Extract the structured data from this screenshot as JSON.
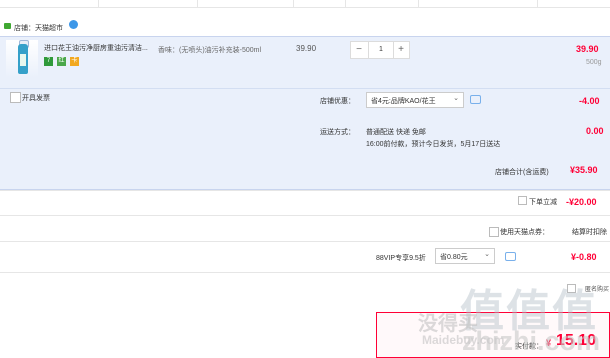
{
  "shop": {
    "label": "店铺：天猫超市"
  },
  "item": {
    "title": "进口花王油污净厨房重油污清洁...",
    "spec": "香味：(无喷头)油污补充装-500ml",
    "unit_price": "39.90",
    "quantity": "1",
    "quantity_minus": "−",
    "quantity_plus": "+",
    "line_price": "39.90",
    "weight": "500g",
    "badges": [
      "7",
      "红",
      "卡"
    ]
  },
  "invoice": {
    "label": "开具发票"
  },
  "promo": {
    "label": "店铺优惠：",
    "selected": "省4元:品牌KAO/花王",
    "chevron": "⌄",
    "amount": "-4.00"
  },
  "shipping": {
    "label": "运送方式：",
    "line1": "普通配送 快递 免邮",
    "line2": "16:00前付款，预计今日发货，5月17日送达",
    "amount": "0.00"
  },
  "subtotal": {
    "label": "店铺合计(含运费)",
    "amount": "¥35.90"
  },
  "discount": {
    "label": "下单立减",
    "amount": "-¥20.00"
  },
  "tmall_points": {
    "label": "使用天猫点券：",
    "right": "结算时扣除"
  },
  "vip": {
    "label": "88VIP专享9.5折",
    "selected": "省0.80元",
    "chevron": "⌄",
    "amount": "¥-0.80"
  },
  "anonymous": {
    "label": "匿名购买"
  },
  "total": {
    "label": "实付款：",
    "currency": "¥",
    "amount": "15.10"
  },
  "watermark": {
    "logo": "值值值",
    "cn": "没得买",
    "en": "Maidebuy.com",
    "url": "zhizhi.com"
  },
  "colors": {
    "accent": "#ff0036",
    "block_bg": "#eaf0fb",
    "link": "#3d97e8"
  }
}
